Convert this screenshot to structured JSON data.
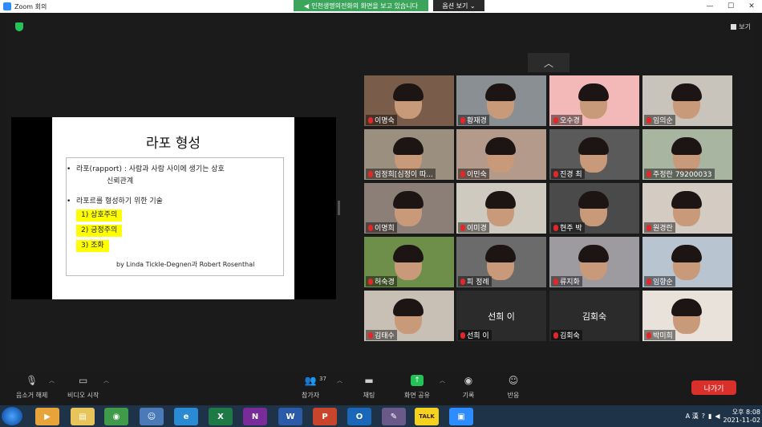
{
  "window": {
    "title": "Zoom 회의",
    "minimize": "—",
    "maximize": "☐",
    "close": "✕"
  },
  "share_banner": {
    "text": "인천생명의전화의 화면을 보고 있습니다",
    "view_options": "옵션 보기 ⌄"
  },
  "meeting": {
    "view_label": "보기"
  },
  "slide": {
    "title": "라포 형성",
    "bullet1": "라포(rapport) : 사람과 사람 사이에 생기는 상호",
    "bullet1_cont": "신뢰관계",
    "bullet2": "라포르를 형성하기 위한 기술",
    "items": [
      "1) 상호주의",
      "2) 긍정주의",
      "3) 조화"
    ],
    "credit": "by Linda Tickle-Degnen과 Robert Rosenthal"
  },
  "gallery": {
    "collapse_icon": "︿",
    "participants": [
      {
        "name": "이명숙",
        "video": true,
        "bg": "#7a5c4a"
      },
      {
        "name": "황재경",
        "video": true,
        "bg": "#8a8f94"
      },
      {
        "name": "오수경",
        "video": true,
        "bg": "#f3b8b8"
      },
      {
        "name": "임의순",
        "video": true,
        "bg": "#c8c4bc"
      },
      {
        "name": "임정희[심정이 따...",
        "video": true,
        "bg": "#9b8f80"
      },
      {
        "name": "이민숙",
        "video": true,
        "bg": "#b39a8a"
      },
      {
        "name": "진경 최",
        "video": true,
        "bg": "#5a5a5a"
      },
      {
        "name": "주정란 79200033",
        "video": true,
        "bg": "#a8b5a0"
      },
      {
        "name": "이명희",
        "video": true,
        "bg": "#8c7f78"
      },
      {
        "name": "이미경",
        "video": true,
        "bg": "#cfcac0"
      },
      {
        "name": "현주 박",
        "video": true,
        "bg": "#4a4a4a"
      },
      {
        "name": "원경란",
        "video": true,
        "bg": "#d4cbc2"
      },
      {
        "name": "허숙경",
        "video": true,
        "bg": "#6e8f4a"
      },
      {
        "name": "피 정례",
        "video": true,
        "bg": "#6b6b6b"
      },
      {
        "name": "류지화",
        "video": true,
        "bg": "#9d9aa0"
      },
      {
        "name": "임향순",
        "video": true,
        "bg": "#b8c4cf"
      },
      {
        "name": "김태수",
        "video": true,
        "bg": "#c8c0b4"
      },
      {
        "name": "선희 이",
        "video": false,
        "bg": "#2b2b2b",
        "display": "선희 이"
      },
      {
        "name": "김회숙",
        "video": false,
        "bg": "#2b2b2b",
        "display": "김회숙"
      },
      {
        "name": "박미희",
        "video": true,
        "bg": "#e8e2da"
      }
    ]
  },
  "toolbar": {
    "mute": "음소거 해제",
    "video": "비디오 시작",
    "participants": "참가자",
    "participants_count": "37",
    "chat": "채팅",
    "share": "화면 공유",
    "record": "기록",
    "reactions": "반응",
    "leave": "나가기"
  },
  "taskbar": {
    "apps": [
      {
        "name": "media-player",
        "label": "▶",
        "color": "#e8a33a"
      },
      {
        "name": "file-explorer",
        "label": "▤",
        "color": "#e8c55a"
      },
      {
        "name": "chrome",
        "label": "◉",
        "color": "#3f9a4a"
      },
      {
        "name": "users",
        "label": "☺",
        "color": "#4a7ab8"
      },
      {
        "name": "edge",
        "label": "e",
        "color": "#2a8ad4"
      },
      {
        "name": "excel",
        "label": "X",
        "color": "#1d7a45"
      },
      {
        "name": "onenote",
        "label": "N",
        "color": "#7a2b9a"
      },
      {
        "name": "word",
        "label": "W",
        "color": "#2b5aa8"
      },
      {
        "name": "powerpoint",
        "label": "P",
        "color": "#c8442a"
      },
      {
        "name": "outlook",
        "label": "O",
        "color": "#1a66b8"
      },
      {
        "name": "paint",
        "label": "✎",
        "color": "#6a5a8a"
      },
      {
        "name": "kakaotalk",
        "label": "TALK",
        "color": "#f5d21e"
      },
      {
        "name": "zoom",
        "label": "▣",
        "color": "#2d8cff"
      }
    ],
    "ime": "A 漢",
    "time": "오후 8:08",
    "date": "2021-11-02"
  }
}
